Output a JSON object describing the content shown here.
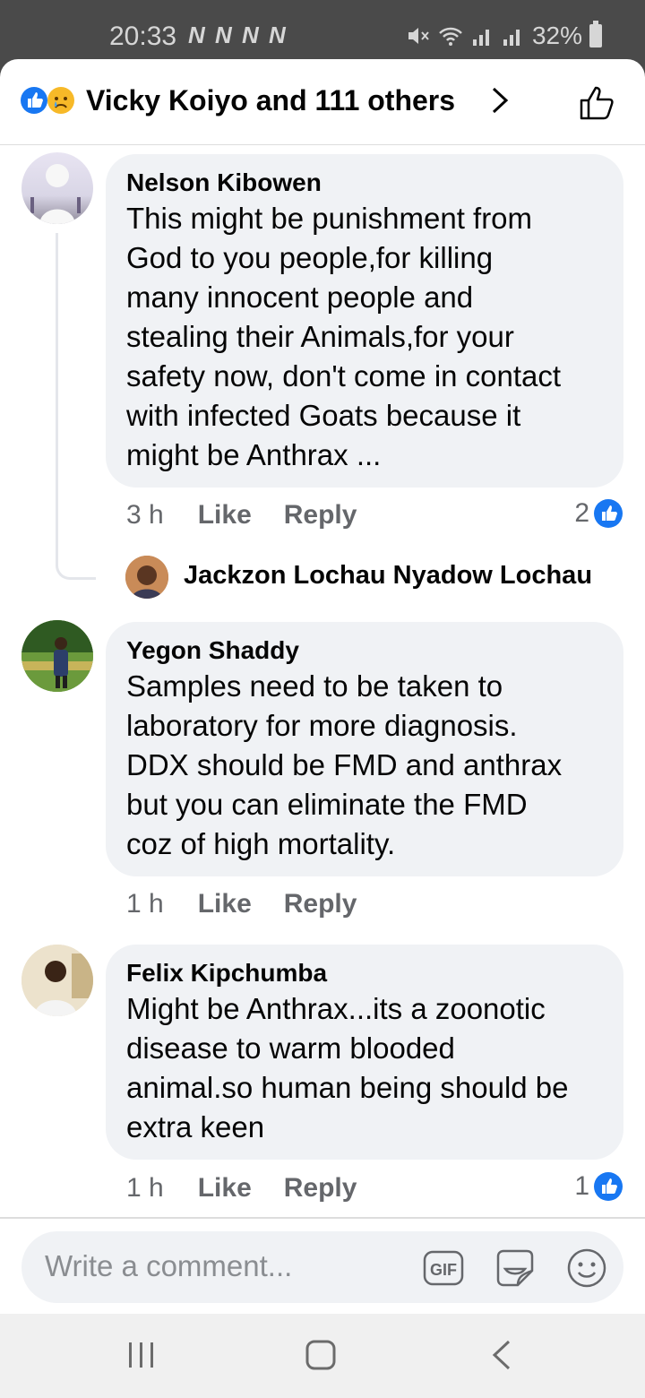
{
  "status_bar": {
    "time": "20:33",
    "notifications": "N N N N",
    "battery": "32%"
  },
  "header": {
    "title": "Vicky Koiyo and 111 others"
  },
  "comments": [
    {
      "author": "Nelson Kibowen",
      "text_lines": [
        "This might be punishment from",
        "God to you people,for killing",
        "many innocent people and",
        "stealing their Animals,for your",
        "safety now, don't come in contact",
        "with infected Goats because it",
        "might be Anthrax ..."
      ],
      "time": "3 h",
      "like_label": "Like",
      "reply_label": "Reply",
      "reaction_count": "2",
      "reply_preview": "Jackzon Lochau Nyadow Lochau"
    },
    {
      "author": "Yegon Shaddy",
      "text_lines": [
        "Samples need to be taken to",
        "laboratory for more diagnosis.",
        "DDX should be FMD and anthrax",
        "but you can eliminate the FMD",
        "coz of high mortality."
      ],
      "time": "1 h",
      "like_label": "Like",
      "reply_label": "Reply"
    },
    {
      "author": "Felix Kipchumba",
      "text_lines": [
        "Might be Anthrax...its a zoonotic",
        "disease to warm blooded",
        "animal.so human being should be",
        "extra keen"
      ],
      "time": "1 h",
      "like_label": "Like",
      "reply_label": "Reply",
      "reaction_count": "1"
    }
  ],
  "composer": {
    "placeholder": "Write a comment...",
    "gif_label": "GIF"
  },
  "colors": {
    "accent": "#1877f2",
    "bubble": "#f0f2f5",
    "muted": "#65676b"
  }
}
